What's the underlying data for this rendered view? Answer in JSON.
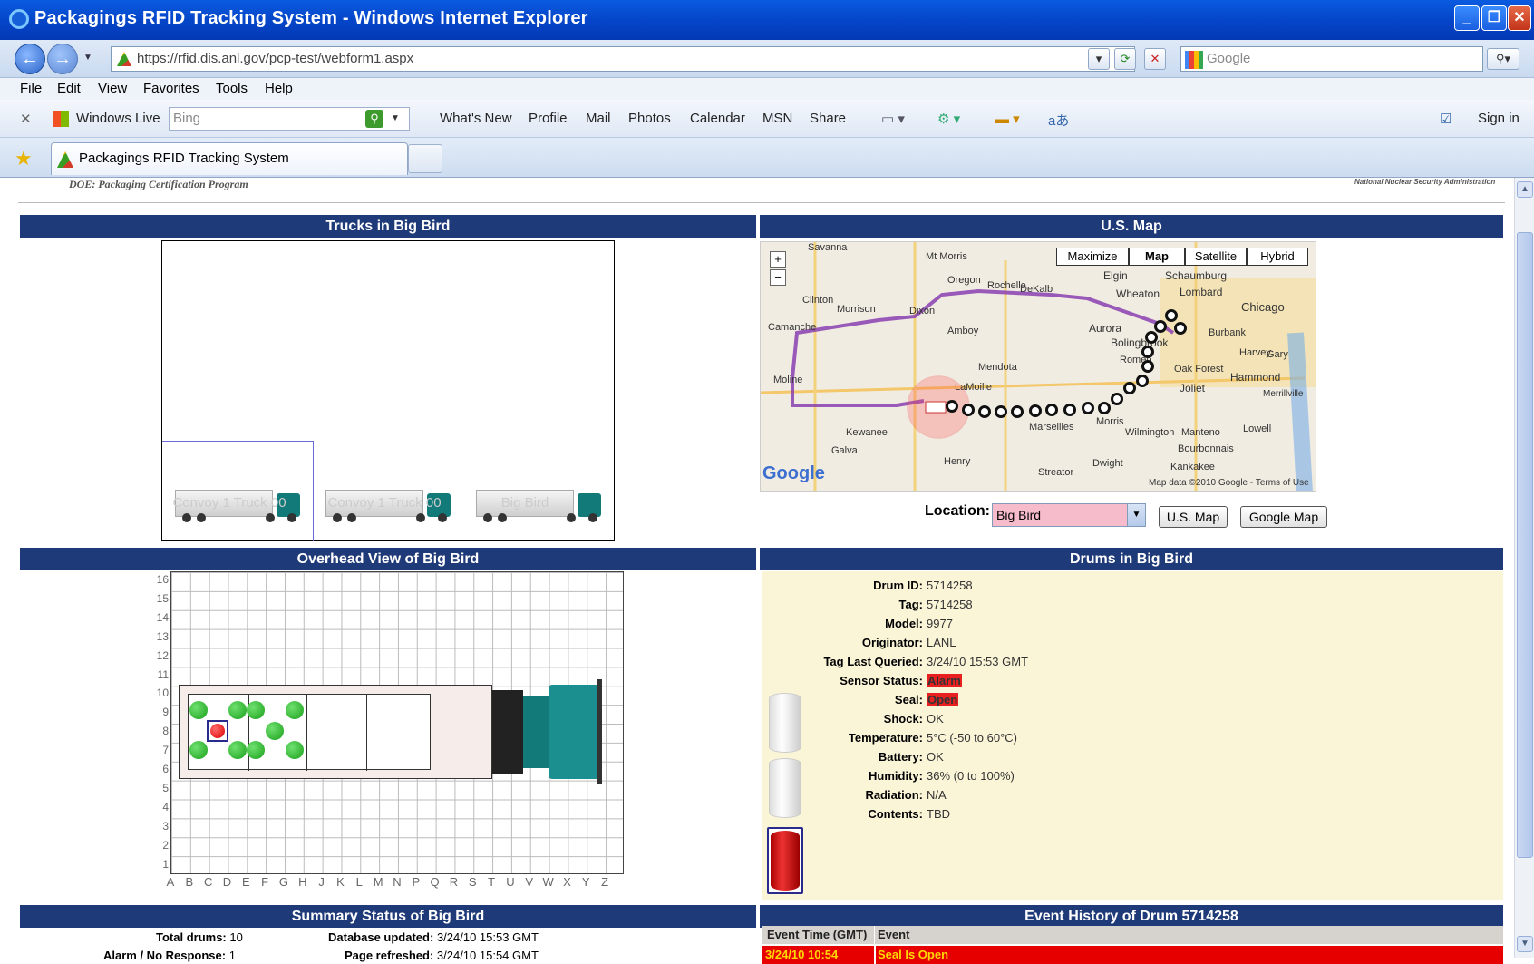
{
  "window": {
    "title": "Packagings RFID Tracking System - Windows Internet Explorer"
  },
  "address": {
    "url": "https://rfid.dis.anl.gov/pcp-test/webform1.aspx",
    "search_placeholder": "Google"
  },
  "menu": [
    "File",
    "Edit",
    "View",
    "Favorites",
    "Tools",
    "Help"
  ],
  "toolbar": {
    "windows_live": "Windows Live",
    "bing_placeholder": "Bing",
    "links": [
      "What's New",
      "Profile",
      "Mail",
      "Photos",
      "Calendar",
      "MSN",
      "Share"
    ],
    "sign_in": "Sign in"
  },
  "tab": {
    "label": "Packagings RFID Tracking System"
  },
  "page": {
    "header_left": "DOE: Packaging Certification Program",
    "header_right": "National Nuclear Security Administration",
    "trucks_title": "Trucks in Big Bird",
    "trucks": [
      "Convoy 1 Truck 00",
      "Convoy 1 Truck 00",
      "Big Bird"
    ],
    "map_title": "U.S. Map",
    "map_buttons": [
      "Maximize",
      "Map",
      "Satellite",
      "Hybrid"
    ],
    "map_credit": "Map data ©2010 Google - Terms of Use",
    "map_places": [
      "Savanna",
      "Mt Morris",
      "Oregon",
      "Rochelle",
      "DeKalb",
      "Elgin",
      "Schaumburg",
      "Wheaton",
      "Lombard",
      "Chicago",
      "Clinton",
      "Morrison",
      "Dixon",
      "Amboy",
      "Aurora",
      "Bolingbrook",
      "Burbank",
      "Camanche",
      "Moline",
      "Mendota",
      "LaMoille",
      "Romeo",
      "Oak Forest",
      "Hammond",
      "Gary",
      "Harvey",
      "Joliet",
      "Merrillville",
      "Kewanee",
      "Marseilles",
      "Morris",
      "Wilmington",
      "Manteno",
      "Lowell",
      "Galva",
      "Henry",
      "Streator",
      "Dwight",
      "Bourbonnais",
      "Kankakee"
    ],
    "location_label": "Location:",
    "location_value": "Big Bird",
    "btn_us_map": "U.S. Map",
    "btn_google_map": "Google Map",
    "overhead_title": "Overhead View of Big Bird",
    "y_labels": [
      "16",
      "15",
      "14",
      "13",
      "12",
      "11",
      "10",
      "9",
      "8",
      "7",
      "6",
      "5",
      "4",
      "3",
      "2",
      "1"
    ],
    "x_labels": [
      "A",
      "B",
      "C",
      "D",
      "E",
      "F",
      "G",
      "H",
      "J",
      "K",
      "L",
      "M",
      "N",
      "P",
      "Q",
      "R",
      "S",
      "T",
      "U",
      "V",
      "W",
      "X",
      "Y",
      "Z"
    ],
    "drums_title": "Drums in Big Bird",
    "drum_fields": [
      {
        "k": "Drum ID:",
        "v": "5714258"
      },
      {
        "k": "Tag:",
        "v": "5714258"
      },
      {
        "k": "Model:",
        "v": "9977"
      },
      {
        "k": "Originator:",
        "v": "LANL"
      },
      {
        "k": "Tag Last Queried:",
        "v": "3/24/10 15:53 GMT"
      },
      {
        "k": "Sensor Status:",
        "v": "Alarm"
      },
      {
        "k": "Seal:",
        "v": "Open"
      },
      {
        "k": "Shock:",
        "v": "OK"
      },
      {
        "k": "Temperature:",
        "v": "5°C (-50 to 60°C)"
      },
      {
        "k": "Battery:",
        "v": "OK"
      },
      {
        "k": "Humidity:",
        "v": "36% (0 to 100%)"
      },
      {
        "k": "Radiation:",
        "v": "N/A"
      },
      {
        "k": "Contents:",
        "v": "TBD"
      }
    ],
    "summary_title": "Summary Status of Big Bird",
    "summary": {
      "total_k": "Total drums:",
      "total_v": "10",
      "alarm_k": "Alarm / No Response:",
      "alarm_v": "1",
      "db_k": "Database updated:",
      "db_v": "3/24/10 15:53 GMT",
      "pr_k": "Page refreshed:",
      "pr_v": "3/24/10 15:54 GMT"
    },
    "event_title": "Event History of Drum 5714258",
    "event_cols": [
      "Event Time (GMT)",
      "Event"
    ],
    "event_row": [
      "3/24/10 10:54",
      "Seal Is Open"
    ]
  },
  "colors": {
    "section_header": "#1f3a78",
    "alarm_bg": "#e82020",
    "alarm_fg": "#ffd800",
    "drum_panel": "#fbf5d8",
    "location_select": "#f7bccb"
  }
}
